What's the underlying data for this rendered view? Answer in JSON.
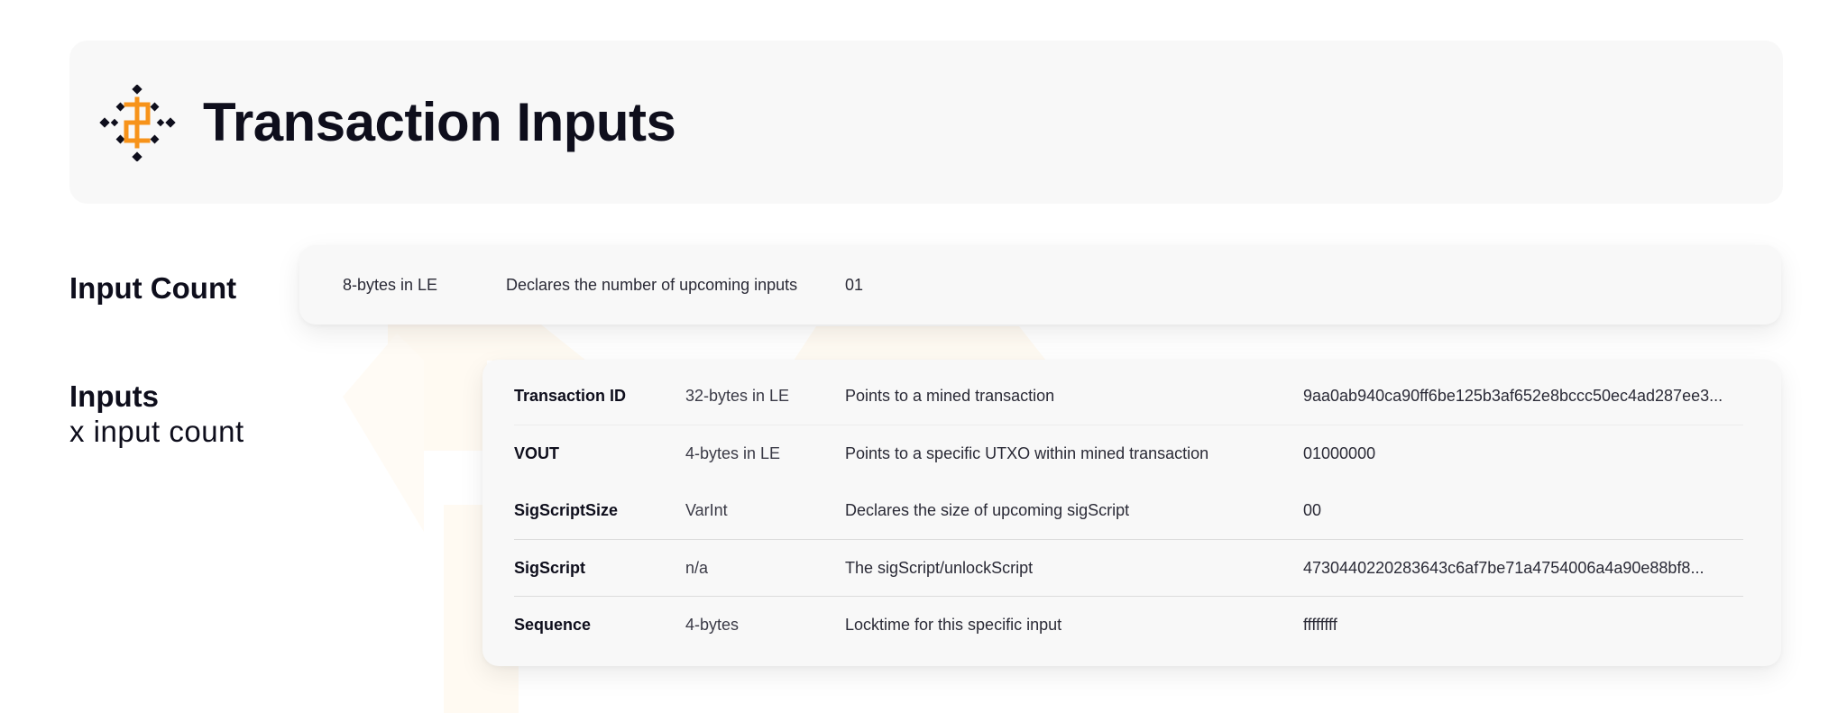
{
  "header": {
    "title": "Transaction Inputs"
  },
  "input_count": {
    "label": "Input Count",
    "size": "8-bytes in LE",
    "description": "Declares the number of upcoming inputs",
    "value": "01"
  },
  "inputs": {
    "label": "Inputs",
    "sublabel": "x input count",
    "rows": [
      {
        "name": "Transaction ID",
        "size": "32-bytes in LE",
        "description": "Points to a mined transaction",
        "value": "9aa0ab940ca90ff6be125b3af652e8bccc50ec4ad287ee3..."
      },
      {
        "name": "VOUT",
        "size": "4-bytes in LE",
        "description": "Points to a specific UTXO within mined transaction",
        "value": "01000000"
      },
      {
        "name": "SigScriptSize",
        "size": "VarInt",
        "description": "Declares the size of upcoming sigScript",
        "value": "00"
      },
      {
        "name": "SigScript",
        "size": "n/a",
        "description": "The sigScript/unlockScript",
        "value": "4730440220283643c6af7be71a4754006a4a90e88bf8..."
      },
      {
        "name": "Sequence",
        "size": "4-bytes",
        "description": "Locktime for this specific input",
        "value": "ffffffff"
      }
    ]
  },
  "colors": {
    "accent": "#f7931a",
    "ink": "#0e0e1c",
    "panel": "#f8f8f8"
  }
}
